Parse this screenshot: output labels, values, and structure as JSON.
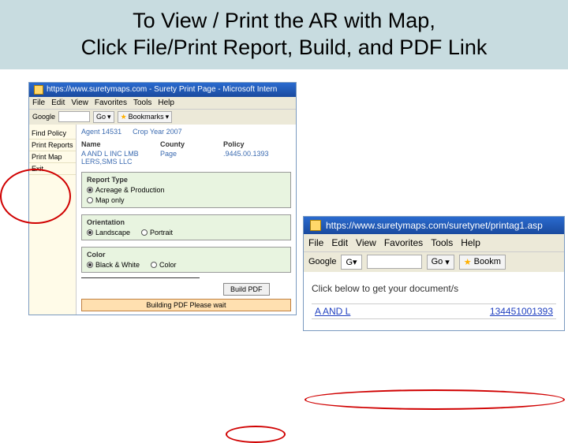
{
  "title": {
    "line1": "To View / Print the AR with Map,",
    "line2": "Click File/Print Report, Build, and PDF Link"
  },
  "win1": {
    "url_title": "https://www.suretymaps.com - Surety Print Page - Microsoft Intern",
    "menu": {
      "file": "File",
      "edit": "Edit",
      "view": "View",
      "favorites": "Favorites",
      "tools": "Tools",
      "help": "Help"
    },
    "toolbar": {
      "google": "Google",
      "searchbox": "",
      "go": "Go",
      "bookmarks": "Bookmarks",
      "more": ""
    },
    "sidebar": {
      "find": "Find Policy",
      "print_reports": "Print Reports",
      "print_map": "Print Map",
      "exit": "Exit"
    },
    "hdr": {
      "agent_label": "Agent",
      "agent_val": "14531",
      "year_label": "Crop Year",
      "year_val": "2007"
    },
    "table": {
      "cols": {
        "name": "Name",
        "county": "County",
        "policy": "Policy"
      },
      "row": {
        "name": "A AND L INC  LMB LERS,SMS LLC",
        "county": "Page",
        "policy": ".9445.00.1393"
      }
    },
    "sections": {
      "report_type": {
        "title": "Report Type",
        "opt1": "Acreage & Production",
        "opt2": "Map only"
      },
      "orientation": {
        "title": "Orientation",
        "opt1": "Landscape",
        "opt2": "Portrait"
      },
      "color": {
        "title": "Color",
        "opt1": "Black & White",
        "opt2": "Color"
      }
    },
    "build_btn": "Build PDF",
    "status": "Building PDF Please wait"
  },
  "win2": {
    "url_title": "https://www.suretymaps.com/suretynet/printag1.asp",
    "menu": {
      "file": "File",
      "edit": "Edit",
      "view": "View",
      "favorites": "Favorites",
      "tools": "Tools",
      "help": "Help"
    },
    "toolbar": {
      "google": "Google",
      "go": "Go",
      "bookmarks": "Bookm"
    },
    "msg": "Click below to get your document/s",
    "link": {
      "name": "A AND L",
      "code": "134451001393"
    }
  }
}
